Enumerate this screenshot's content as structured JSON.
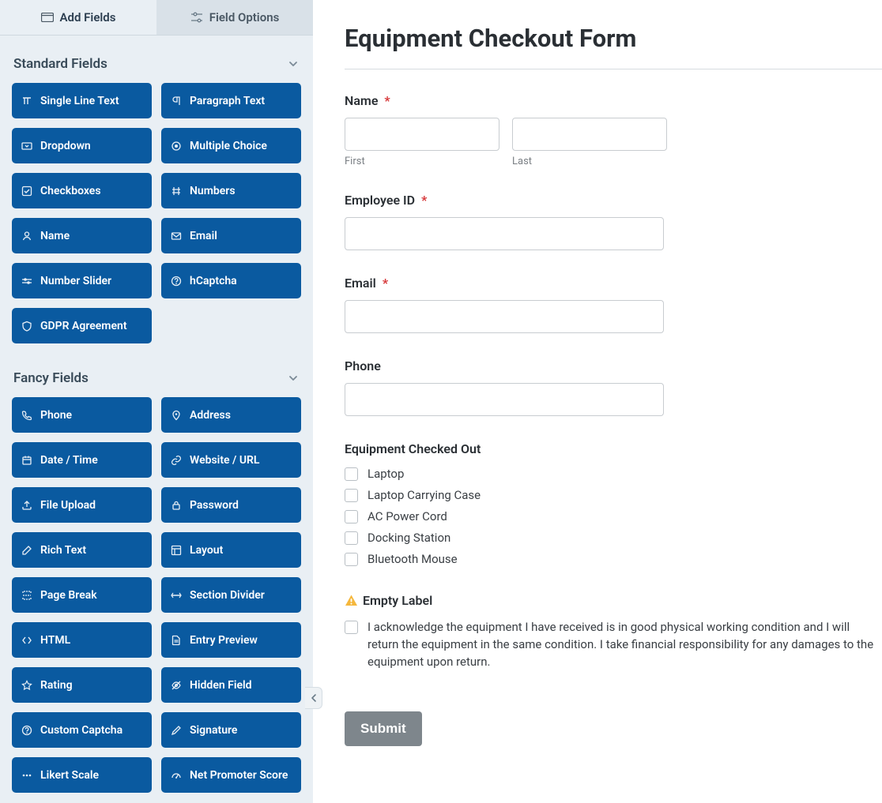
{
  "tabs": {
    "add_fields": "Add Fields",
    "field_options": "Field Options"
  },
  "sidebar": {
    "groups": [
      {
        "title": "Standard Fields",
        "items": [
          {
            "label": "Single Line Text",
            "icon": "text-icon"
          },
          {
            "label": "Paragraph Text",
            "icon": "paragraph-icon"
          },
          {
            "label": "Dropdown",
            "icon": "dropdown-icon"
          },
          {
            "label": "Multiple Choice",
            "icon": "radio-icon"
          },
          {
            "label": "Checkboxes",
            "icon": "check-icon"
          },
          {
            "label": "Numbers",
            "icon": "hash-icon"
          },
          {
            "label": "Name",
            "icon": "user-icon"
          },
          {
            "label": "Email",
            "icon": "envelope-icon"
          },
          {
            "label": "Number Slider",
            "icon": "slider-icon"
          },
          {
            "label": "hCaptcha",
            "icon": "help-icon"
          },
          {
            "label": "GDPR Agreement",
            "icon": "shield-icon"
          }
        ]
      },
      {
        "title": "Fancy Fields",
        "items": [
          {
            "label": "Phone",
            "icon": "phone-icon"
          },
          {
            "label": "Address",
            "icon": "pin-icon"
          },
          {
            "label": "Date / Time",
            "icon": "calendar-icon"
          },
          {
            "label": "Website / URL",
            "icon": "link-icon"
          },
          {
            "label": "File Upload",
            "icon": "upload-icon"
          },
          {
            "label": "Password",
            "icon": "lock-icon"
          },
          {
            "label": "Rich Text",
            "icon": "edit-icon"
          },
          {
            "label": "Layout",
            "icon": "layout-icon"
          },
          {
            "label": "Page Break",
            "icon": "pagebreak-icon"
          },
          {
            "label": "Section Divider",
            "icon": "divider-icon"
          },
          {
            "label": "HTML",
            "icon": "code-icon"
          },
          {
            "label": "Entry Preview",
            "icon": "doc-icon"
          },
          {
            "label": "Rating",
            "icon": "star-icon"
          },
          {
            "label": "Hidden Field",
            "icon": "eye-off-icon"
          },
          {
            "label": "Custom Captcha",
            "icon": "help-icon"
          },
          {
            "label": "Signature",
            "icon": "pen-icon"
          },
          {
            "label": "Likert Scale",
            "icon": "ellipsis-icon"
          },
          {
            "label": "Net Promoter Score",
            "icon": "gauge-icon"
          }
        ]
      }
    ]
  },
  "form": {
    "title": "Equipment Checkout Form",
    "name": {
      "label": "Name",
      "required": true,
      "first_sublabel": "First",
      "last_sublabel": "Last"
    },
    "employee_id": {
      "label": "Employee ID",
      "required": true
    },
    "email": {
      "label": "Email",
      "required": true
    },
    "phone": {
      "label": "Phone",
      "required": false
    },
    "equipment": {
      "label": "Equipment Checked Out",
      "options": [
        "Laptop",
        "Laptop Carrying Case",
        "AC Power Cord",
        "Docking Station",
        "Bluetooth Mouse"
      ]
    },
    "ack": {
      "warning_label": "Empty Label",
      "text": "I acknowledge the equipment I have received is in good physical working condition and I will return the equipment in the same condition. I take financial responsibility for any damages to the equipment upon return."
    },
    "submit_label": "Submit",
    "asterisk": "*"
  }
}
